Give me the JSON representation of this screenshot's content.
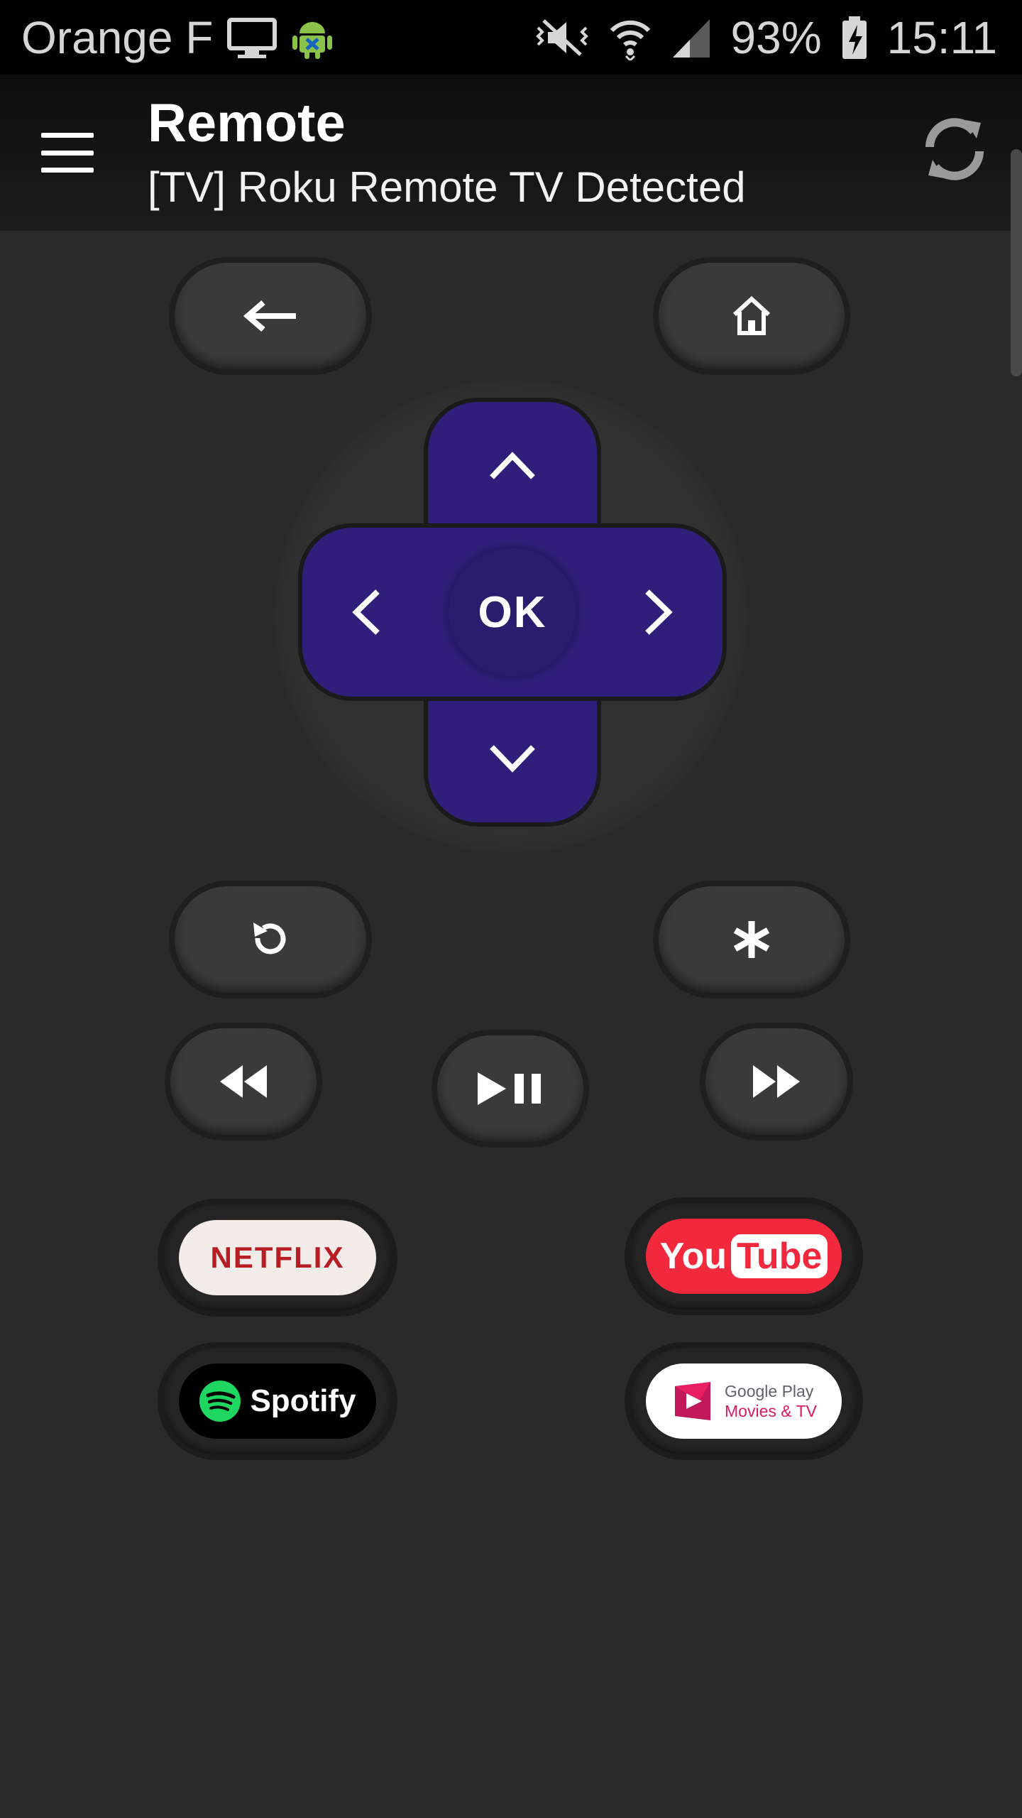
{
  "status_bar": {
    "carrier": "Orange F",
    "battery": "93%",
    "time": "15:11",
    "icons": [
      "tv-icon",
      "android-icon",
      "mute-vibrate-icon",
      "wifi-icon",
      "signal-icon",
      "battery-charging-icon"
    ]
  },
  "app_bar": {
    "title": "Remote",
    "subtitle": "[TV] Roku Remote TV Detected",
    "menu_icon": "hamburger-icon",
    "refresh_icon": "refresh-icon"
  },
  "remote": {
    "ok_label": "OK",
    "buttons": [
      "back-arrow-icon",
      "home-icon",
      "up-chevron-icon",
      "down-chevron-icon",
      "left-chevron-icon",
      "right-chevron-icon",
      "replay-icon",
      "asterisk-icon",
      "rewind-icon",
      "play-pause-icon",
      "fast-forward-icon"
    ],
    "dpad_color": "#2f1f7a"
  },
  "apps": {
    "netflix": "NETFLIX",
    "youtube_you": "You",
    "youtube_tube": "Tube",
    "spotify": "Spotify",
    "google_play_line1": "Google Play",
    "google_play_line2": "Movies & TV",
    "colors": {
      "netflix_red": "#b81d24",
      "youtube_red": "#f2283c",
      "spotify_green": "#1ed760"
    }
  }
}
